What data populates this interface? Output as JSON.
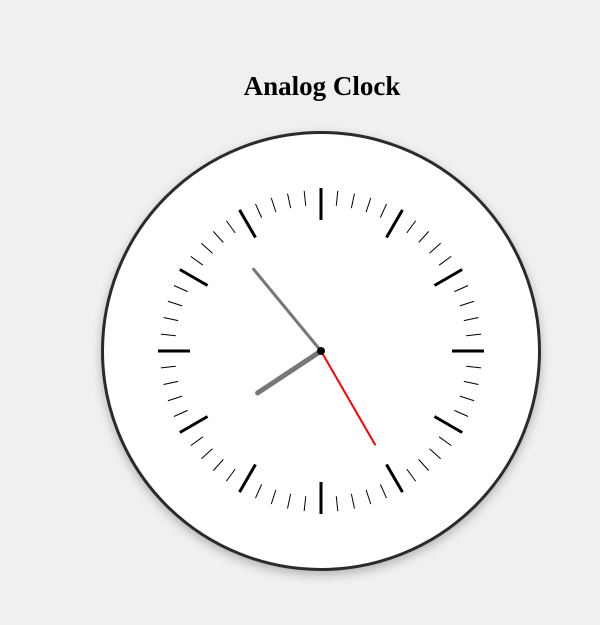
{
  "page": {
    "title": "Analog Clock"
  },
  "clock": {
    "time": {
      "hours": 7,
      "minutes": 53,
      "seconds": 25
    },
    "hand_colors": {
      "hour": "#777777",
      "minute": "#777777",
      "second": "#ff0000"
    },
    "tick_color": "#000000",
    "center_color": "#000000",
    "face_color": "#ffffff",
    "border_color": "#2b2b2b"
  }
}
